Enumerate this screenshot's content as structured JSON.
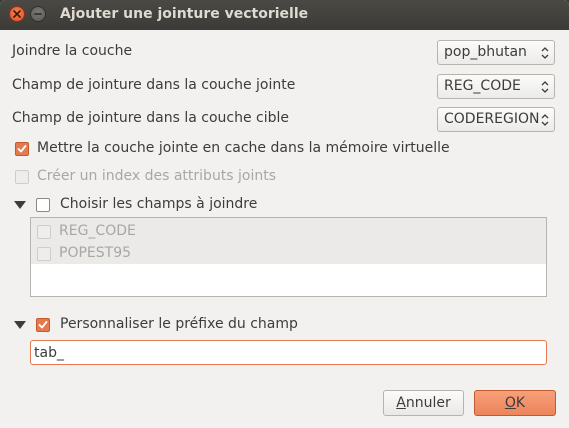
{
  "window": {
    "title": "Ajouter une jointure vectorielle"
  },
  "form": {
    "join_layer": {
      "label": "Joindre la couche",
      "value": "pop_bhutan"
    },
    "join_field": {
      "label": "Champ de jointure dans la couche jointe",
      "value": "REG_CODE"
    },
    "target_field": {
      "label": "Champ de jointure dans la couche cible",
      "value": "CODEREGION"
    },
    "cache": {
      "label": "Mettre la couche jointe en cache dans la mémoire virtuelle",
      "checked": true
    },
    "index": {
      "label": "Créer un index des attributs joints",
      "checked": false,
      "enabled": false
    },
    "choose_fields": {
      "label": "Choisir les champs à joindre",
      "checked": false,
      "items": [
        {
          "label": "REG_CODE",
          "checked": false
        },
        {
          "label": "POPEST95",
          "checked": false
        }
      ]
    },
    "prefix": {
      "label": "Personnaliser le préfixe du champ",
      "checked": true,
      "value": "tab_"
    }
  },
  "buttons": {
    "cancel_first": "A",
    "cancel_rest": "nnuler",
    "ok_first": "O",
    "ok_rest": "K"
  },
  "colors": {
    "accent": "#e57a4f",
    "titlebar": "#3c3b37",
    "background": "#f2f1f0"
  }
}
